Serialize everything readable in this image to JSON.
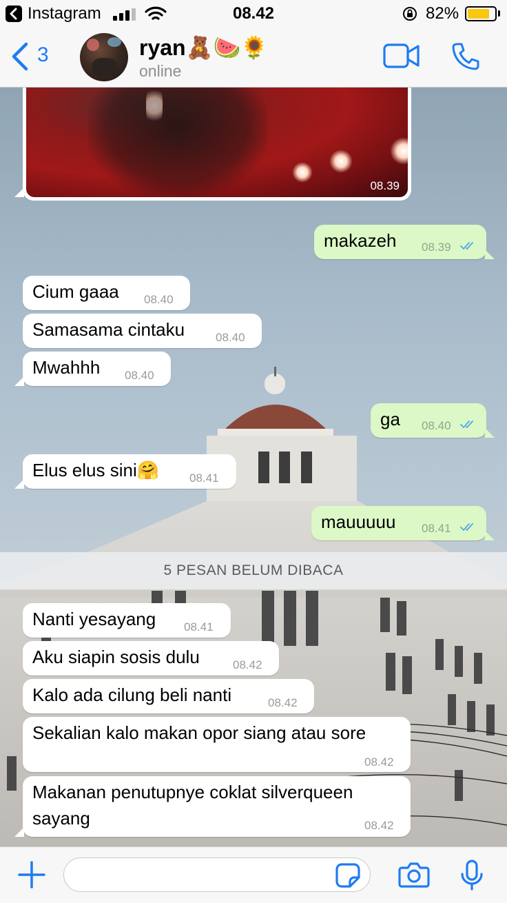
{
  "status_bar": {
    "app": "Instagram",
    "time": "08.42",
    "battery_percent_label": "82%",
    "battery_level": 0.82
  },
  "header": {
    "back_count": "3",
    "contact_name": "ryan🧸🍉🌻",
    "contact_status": "online",
    "accent_color": "#1d7cf2"
  },
  "messages": [
    {
      "dir": "in",
      "type": "image",
      "time": "08.39"
    },
    {
      "dir": "out",
      "text": "makazeh",
      "time": "08.39",
      "read": true
    },
    {
      "dir": "in",
      "text": "Cium gaaa",
      "time": "08.40"
    },
    {
      "dir": "in",
      "text": "Samasama cintaku",
      "time": "08.40"
    },
    {
      "dir": "in",
      "text": "Mwahhh",
      "time": "08.40"
    },
    {
      "dir": "out",
      "text": "ga",
      "time": "08.40",
      "read": true
    },
    {
      "dir": "in",
      "text": "Elus elus sini🤗",
      "time": "08.41"
    },
    {
      "dir": "out",
      "text": "mauuuuu",
      "time": "08.41",
      "read": true
    },
    {
      "dir": "in",
      "text": "Nanti yesayang",
      "time": "08.41"
    },
    {
      "dir": "in",
      "text": "Aku siapin sosis dulu",
      "time": "08.42"
    },
    {
      "dir": "in",
      "text": "Kalo ada cilung beli nanti",
      "time": "08.42"
    },
    {
      "dir": "in",
      "text": "Sekalian kalo makan opor siang atau sore",
      "time": "08.42"
    },
    {
      "dir": "in",
      "text_line1": "Makanan penutupnye coklat silverqueen",
      "text_line2": "sayang",
      "time": "08.42"
    }
  ],
  "unread_banner": "5 PESAN BELUM DIBACA",
  "input": {
    "value": "",
    "placeholder": ""
  },
  "colors": {
    "incoming_bubble": "#ffffff",
    "outgoing_bubble": "#dcf8c6",
    "read_ticks": "#4fa8e8"
  }
}
